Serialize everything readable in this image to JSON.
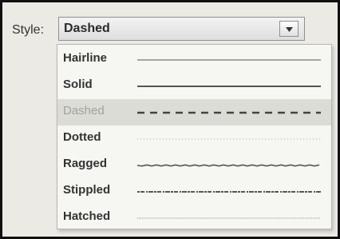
{
  "label": "Style:",
  "select": {
    "value": "Dashed",
    "icon": "dropdown-arrow-icon"
  },
  "options": [
    {
      "label": "Hairline",
      "style": "hairline",
      "selected": false
    },
    {
      "label": "Solid",
      "style": "solid",
      "selected": false
    },
    {
      "label": "Dashed",
      "style": "dashed",
      "selected": true
    },
    {
      "label": "Dotted",
      "style": "dotted",
      "selected": false
    },
    {
      "label": "Ragged",
      "style": "ragged",
      "selected": false
    },
    {
      "label": "Stippled",
      "style": "stippled",
      "selected": false
    },
    {
      "label": "Hatched",
      "style": "hatched",
      "selected": false
    }
  ],
  "colors": {
    "frame_bg": "#ebeae5",
    "list_bg": "#f6f6f3",
    "selected_bg": "#dcdcd7",
    "line": "#555555"
  }
}
